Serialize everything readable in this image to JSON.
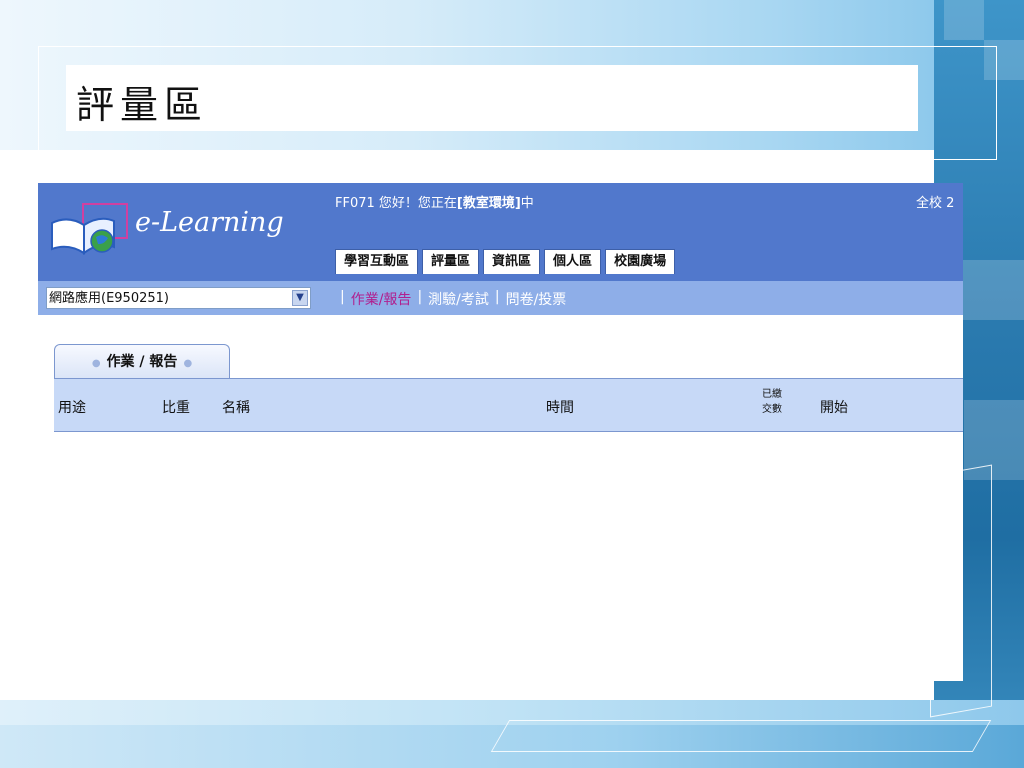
{
  "slide": {
    "title": "評量區"
  },
  "header": {
    "logo_text": "e-Learning",
    "greeting": "FF071 您好！您正在",
    "location": "[教室環境]",
    "greeting_end": "中",
    "school": "全校 2"
  },
  "main_tabs": [
    {
      "label": "學習互動區"
    },
    {
      "label": "評量區"
    },
    {
      "label": "資訊區"
    },
    {
      "label": "個人區"
    },
    {
      "label": "校園廣場"
    }
  ],
  "course_select": {
    "value": "網路應用(E950251)"
  },
  "subnav": [
    {
      "label": "作業/報告",
      "active": true
    },
    {
      "label": "測驗/考試",
      "active": false
    },
    {
      "label": "問卷/投票",
      "active": false
    }
  ],
  "content_tab": {
    "label": "作業 / 報告"
  },
  "table": {
    "columns": [
      "用途",
      "比重",
      "名稱",
      "時間",
      "已繳交數",
      "開始"
    ],
    "col_small_top": "已繳",
    "col_small_bottom": "交數"
  },
  "colors": {
    "header_bg": "#5178cc",
    "subbar_bg": "#8eaee8",
    "active_link": "#b0208f",
    "table_head": "#c7d9f7"
  }
}
